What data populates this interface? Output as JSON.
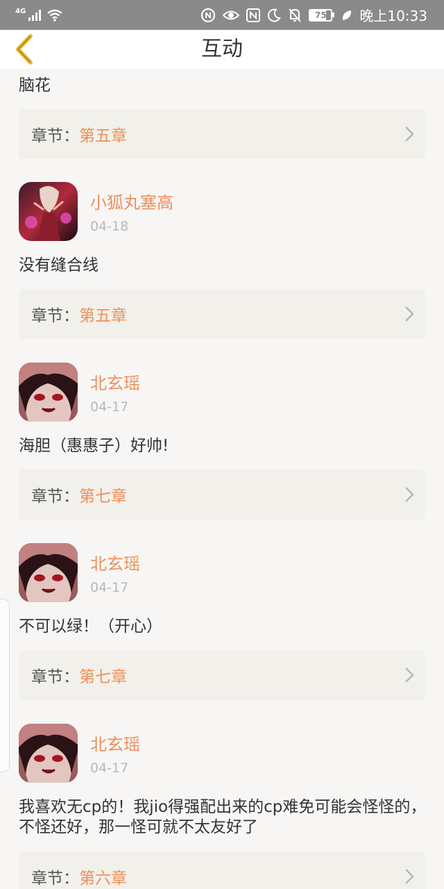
{
  "statusbar": {
    "network": "4G",
    "battery": "75",
    "battery_level": 0.75,
    "time": "晚上10:33"
  },
  "navbar": {
    "title": "互动"
  },
  "chapter_label": "章节：",
  "colors": {
    "accent": "#ee8f5b",
    "chapter_bg": "#f1f0ea",
    "page_bg": "#f7f6f5"
  },
  "comments": [
    {
      "text": "脑花",
      "chapter": "第五章"
    },
    {
      "username": "小狐丸塞高",
      "date": "04-18",
      "text": "没有缝合线",
      "chapter": "第五章"
    },
    {
      "username": "北玄瑶",
      "date": "04-17",
      "text": "海胆（惠惠子）好帅!",
      "chapter": "第七章"
    },
    {
      "username": "北玄瑶",
      "date": "04-17",
      "text": "不可以绿！（开心）",
      "chapter": "第七章"
    },
    {
      "username": "北玄瑶",
      "date": "04-17",
      "text": "我喜欢无cp的！我jio得强配出来的cp难免可能会怪怪的，不怪还好，那一怪可就不太友好了",
      "chapter": "第六章"
    }
  ]
}
